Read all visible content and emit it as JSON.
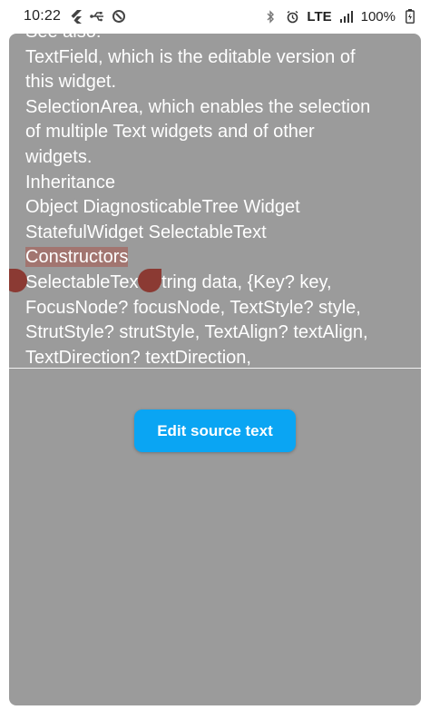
{
  "status_bar": {
    "time": "10:22",
    "left_icons": [
      "flutter-icon",
      "usb-icon",
      "sync-icon"
    ],
    "right_icons": [
      "bluetooth-icon",
      "alarm-icon",
      "signal-icon",
      "battery-icon"
    ],
    "network": "LTE",
    "battery": "100%"
  },
  "content": {
    "lines": [
      "TextField, which is the editable version of",
      "this widget.",
      "SelectionArea, which enables the selection",
      "of multiple Text widgets and of other",
      "widgets.",
      "Inheritance",
      "Object DiagnosticableTree Widget",
      "StatefulWidget SelectableText",
      "Constructors",
      "SelectableText(String data, {Key? key,",
      "FocusNode? focusNode, TextStyle? style,",
      "StrutStyle? strutStyle, TextAlign? textAlign,",
      "TextDirection? textDirection,"
    ],
    "partial_top_line": "See also:",
    "selected_text": "Constructors"
  },
  "button": {
    "label": "Edit source text"
  },
  "colors": {
    "sheet": "#9b9b9b",
    "button": "#0aa5f3",
    "selection_handle": "#8b3a33"
  }
}
